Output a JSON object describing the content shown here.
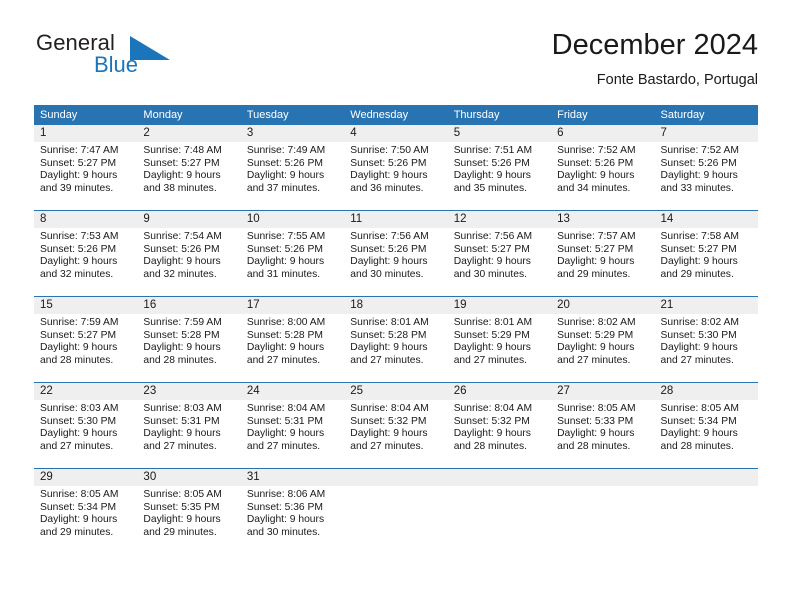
{
  "brand": {
    "name_part1": "General",
    "name_part2": "Blue",
    "flag_icon": "triangle-flag-icon",
    "accent_color": "#1b75bb"
  },
  "header": {
    "title": "December 2024",
    "location": "Fonte Bastardo, Portugal"
  },
  "calendar": {
    "header_background": "#2874b2",
    "day_number_background": "#efefef",
    "weekdays": [
      "Sunday",
      "Monday",
      "Tuesday",
      "Wednesday",
      "Thursday",
      "Friday",
      "Saturday"
    ],
    "weeks": [
      [
        {
          "day": "1",
          "sunrise": "Sunrise: 7:47 AM",
          "sunset": "Sunset: 5:27 PM",
          "daylight_line1": "Daylight: 9 hours",
          "daylight_line2": "and 39 minutes."
        },
        {
          "day": "2",
          "sunrise": "Sunrise: 7:48 AM",
          "sunset": "Sunset: 5:27 PM",
          "daylight_line1": "Daylight: 9 hours",
          "daylight_line2": "and 38 minutes."
        },
        {
          "day": "3",
          "sunrise": "Sunrise: 7:49 AM",
          "sunset": "Sunset: 5:26 PM",
          "daylight_line1": "Daylight: 9 hours",
          "daylight_line2": "and 37 minutes."
        },
        {
          "day": "4",
          "sunrise": "Sunrise: 7:50 AM",
          "sunset": "Sunset: 5:26 PM",
          "daylight_line1": "Daylight: 9 hours",
          "daylight_line2": "and 36 minutes."
        },
        {
          "day": "5",
          "sunrise": "Sunrise: 7:51 AM",
          "sunset": "Sunset: 5:26 PM",
          "daylight_line1": "Daylight: 9 hours",
          "daylight_line2": "and 35 minutes."
        },
        {
          "day": "6",
          "sunrise": "Sunrise: 7:52 AM",
          "sunset": "Sunset: 5:26 PM",
          "daylight_line1": "Daylight: 9 hours",
          "daylight_line2": "and 34 minutes."
        },
        {
          "day": "7",
          "sunrise": "Sunrise: 7:52 AM",
          "sunset": "Sunset: 5:26 PM",
          "daylight_line1": "Daylight: 9 hours",
          "daylight_line2": "and 33 minutes."
        }
      ],
      [
        {
          "day": "8",
          "sunrise": "Sunrise: 7:53 AM",
          "sunset": "Sunset: 5:26 PM",
          "daylight_line1": "Daylight: 9 hours",
          "daylight_line2": "and 32 minutes."
        },
        {
          "day": "9",
          "sunrise": "Sunrise: 7:54 AM",
          "sunset": "Sunset: 5:26 PM",
          "daylight_line1": "Daylight: 9 hours",
          "daylight_line2": "and 32 minutes."
        },
        {
          "day": "10",
          "sunrise": "Sunrise: 7:55 AM",
          "sunset": "Sunset: 5:26 PM",
          "daylight_line1": "Daylight: 9 hours",
          "daylight_line2": "and 31 minutes."
        },
        {
          "day": "11",
          "sunrise": "Sunrise: 7:56 AM",
          "sunset": "Sunset: 5:26 PM",
          "daylight_line1": "Daylight: 9 hours",
          "daylight_line2": "and 30 minutes."
        },
        {
          "day": "12",
          "sunrise": "Sunrise: 7:56 AM",
          "sunset": "Sunset: 5:27 PM",
          "daylight_line1": "Daylight: 9 hours",
          "daylight_line2": "and 30 minutes."
        },
        {
          "day": "13",
          "sunrise": "Sunrise: 7:57 AM",
          "sunset": "Sunset: 5:27 PM",
          "daylight_line1": "Daylight: 9 hours",
          "daylight_line2": "and 29 minutes."
        },
        {
          "day": "14",
          "sunrise": "Sunrise: 7:58 AM",
          "sunset": "Sunset: 5:27 PM",
          "daylight_line1": "Daylight: 9 hours",
          "daylight_line2": "and 29 minutes."
        }
      ],
      [
        {
          "day": "15",
          "sunrise": "Sunrise: 7:59 AM",
          "sunset": "Sunset: 5:27 PM",
          "daylight_line1": "Daylight: 9 hours",
          "daylight_line2": "and 28 minutes."
        },
        {
          "day": "16",
          "sunrise": "Sunrise: 7:59 AM",
          "sunset": "Sunset: 5:28 PM",
          "daylight_line1": "Daylight: 9 hours",
          "daylight_line2": "and 28 minutes."
        },
        {
          "day": "17",
          "sunrise": "Sunrise: 8:00 AM",
          "sunset": "Sunset: 5:28 PM",
          "daylight_line1": "Daylight: 9 hours",
          "daylight_line2": "and 27 minutes."
        },
        {
          "day": "18",
          "sunrise": "Sunrise: 8:01 AM",
          "sunset": "Sunset: 5:28 PM",
          "daylight_line1": "Daylight: 9 hours",
          "daylight_line2": "and 27 minutes."
        },
        {
          "day": "19",
          "sunrise": "Sunrise: 8:01 AM",
          "sunset": "Sunset: 5:29 PM",
          "daylight_line1": "Daylight: 9 hours",
          "daylight_line2": "and 27 minutes."
        },
        {
          "day": "20",
          "sunrise": "Sunrise: 8:02 AM",
          "sunset": "Sunset: 5:29 PM",
          "daylight_line1": "Daylight: 9 hours",
          "daylight_line2": "and 27 minutes."
        },
        {
          "day": "21",
          "sunrise": "Sunrise: 8:02 AM",
          "sunset": "Sunset: 5:30 PM",
          "daylight_line1": "Daylight: 9 hours",
          "daylight_line2": "and 27 minutes."
        }
      ],
      [
        {
          "day": "22",
          "sunrise": "Sunrise: 8:03 AM",
          "sunset": "Sunset: 5:30 PM",
          "daylight_line1": "Daylight: 9 hours",
          "daylight_line2": "and 27 minutes."
        },
        {
          "day": "23",
          "sunrise": "Sunrise: 8:03 AM",
          "sunset": "Sunset: 5:31 PM",
          "daylight_line1": "Daylight: 9 hours",
          "daylight_line2": "and 27 minutes."
        },
        {
          "day": "24",
          "sunrise": "Sunrise: 8:04 AM",
          "sunset": "Sunset: 5:31 PM",
          "daylight_line1": "Daylight: 9 hours",
          "daylight_line2": "and 27 minutes."
        },
        {
          "day": "25",
          "sunrise": "Sunrise: 8:04 AM",
          "sunset": "Sunset: 5:32 PM",
          "daylight_line1": "Daylight: 9 hours",
          "daylight_line2": "and 27 minutes."
        },
        {
          "day": "26",
          "sunrise": "Sunrise: 8:04 AM",
          "sunset": "Sunset: 5:32 PM",
          "daylight_line1": "Daylight: 9 hours",
          "daylight_line2": "and 28 minutes."
        },
        {
          "day": "27",
          "sunrise": "Sunrise: 8:05 AM",
          "sunset": "Sunset: 5:33 PM",
          "daylight_line1": "Daylight: 9 hours",
          "daylight_line2": "and 28 minutes."
        },
        {
          "day": "28",
          "sunrise": "Sunrise: 8:05 AM",
          "sunset": "Sunset: 5:34 PM",
          "daylight_line1": "Daylight: 9 hours",
          "daylight_line2": "and 28 minutes."
        }
      ],
      [
        {
          "day": "29",
          "sunrise": "Sunrise: 8:05 AM",
          "sunset": "Sunset: 5:34 PM",
          "daylight_line1": "Daylight: 9 hours",
          "daylight_line2": "and 29 minutes."
        },
        {
          "day": "30",
          "sunrise": "Sunrise: 8:05 AM",
          "sunset": "Sunset: 5:35 PM",
          "daylight_line1": "Daylight: 9 hours",
          "daylight_line2": "and 29 minutes."
        },
        {
          "day": "31",
          "sunrise": "Sunrise: 8:06 AM",
          "sunset": "Sunset: 5:36 PM",
          "daylight_line1": "Daylight: 9 hours",
          "daylight_line2": "and 30 minutes."
        },
        {
          "day": "",
          "sunrise": "",
          "sunset": "",
          "daylight_line1": "",
          "daylight_line2": ""
        },
        {
          "day": "",
          "sunrise": "",
          "sunset": "",
          "daylight_line1": "",
          "daylight_line2": ""
        },
        {
          "day": "",
          "sunrise": "",
          "sunset": "",
          "daylight_line1": "",
          "daylight_line2": ""
        },
        {
          "day": "",
          "sunrise": "",
          "sunset": "",
          "daylight_line1": "",
          "daylight_line2": ""
        }
      ]
    ]
  }
}
